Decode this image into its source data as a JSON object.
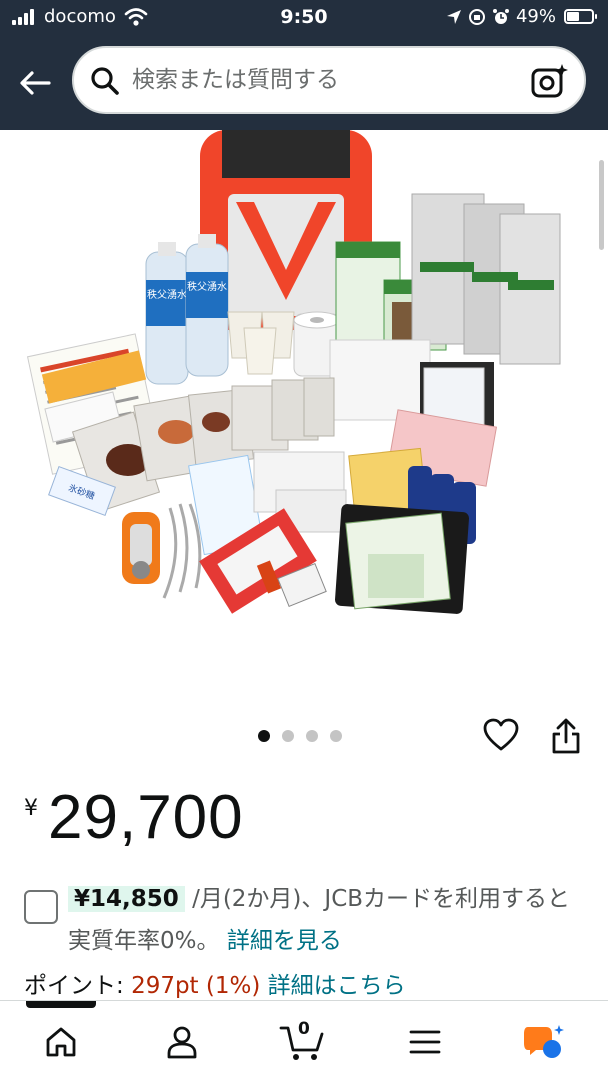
{
  "status_bar": {
    "carrier": "docomo",
    "time": "9:50",
    "battery": "49%",
    "battery_level": 0.49
  },
  "search": {
    "placeholder": "検索または質問する"
  },
  "carousel": {
    "total": 4,
    "active_index": 0
  },
  "product_image": {
    "labels": {
      "water_brand": "秩父湧水",
      "sugar": "氷砂糖"
    }
  },
  "price": {
    "symbol": "¥",
    "value": "29,700"
  },
  "installment": {
    "amount": "¥14,850",
    "text": " /月(2か月)、JCBカードを利用すると実質年率0%。 ",
    "link": "詳細を見る"
  },
  "points": {
    "label": "ポイント: ",
    "value": "297pt  (1%)",
    "link": "詳細はこちら"
  },
  "nav": {
    "cart_count": "0"
  },
  "colors": {
    "header_bg": "#232f3e",
    "link": "#007185",
    "points": "#b12704",
    "installment_highlight": "#dff6ed",
    "assistant_orange": "#ff7b1a",
    "assistant_blue": "#1a73e8"
  }
}
